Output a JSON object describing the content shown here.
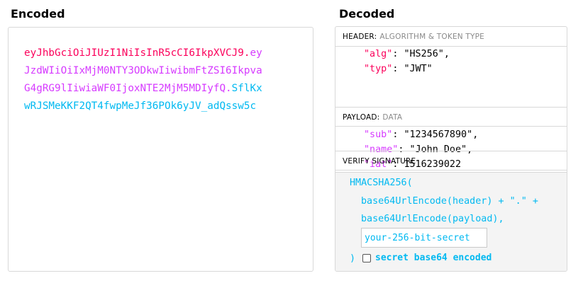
{
  "encoded": {
    "title": "Encoded",
    "lines": [
      [
        {
          "text": "eyJhbGciOiJIUzI1NiIsInR5cCI6IkpXVCJ9",
          "part": "header"
        },
        {
          "text": ".",
          "part": "header"
        },
        {
          "text": "ey",
          "part": "payload"
        }
      ],
      [
        {
          "text": "JzdWIiOiIxMjM0NTY3ODkwIiwibmFtZSI6Ikpva",
          "part": "payload"
        }
      ],
      [
        {
          "text": "G4gRG9lIiwiaWF0IjoxNTE2MjM5MDIyfQ",
          "part": "payload"
        },
        {
          "text": ".",
          "part": "payload"
        },
        {
          "text": "SflKx",
          "part": "signature"
        }
      ],
      [
        {
          "text": "wRJSMeKKF2QT4fwpMeJf36POk6yJV_adQssw5c",
          "part": "signature"
        }
      ]
    ]
  },
  "decoded": {
    "title": "Decoded",
    "header": {
      "label": "HEADER:",
      "sublabel": "ALGORITHM & TOKEN TYPE",
      "lines": [
        {
          "key": "\"alg\"",
          "sep": ": ",
          "value": "\"HS256\"",
          "trail": ","
        },
        {
          "key": "\"typ\"",
          "sep": ": ",
          "value": "\"JWT\"",
          "trail": ""
        }
      ]
    },
    "payload": {
      "label": "PAYLOAD:",
      "sublabel": "DATA",
      "lines": [
        {
          "key": "\"sub\"",
          "sep": ": ",
          "value": "\"1234567890\"",
          "trail": ","
        },
        {
          "key": "\"name\"",
          "sep": ": ",
          "value": "\"John Doe\"",
          "trail": ","
        },
        {
          "key": "\"iat\"",
          "sep": ": ",
          "value": "1516239022",
          "trail": ""
        }
      ]
    },
    "verify": {
      "label": "VERIFY SIGNATURE",
      "line1": "HMACSHA256(",
      "line2": "base64UrlEncode(header) + \".\" +",
      "line3": "base64UrlEncode(payload),",
      "secret_placeholder": "your-256-bit-secret",
      "secret_value": "",
      "close": ")",
      "checkbox_label": "secret base64 encoded",
      "checkbox_checked": false
    }
  },
  "colors": {
    "header": "#fb015b",
    "payload": "#d63aff",
    "signature": "#00b9f1"
  }
}
